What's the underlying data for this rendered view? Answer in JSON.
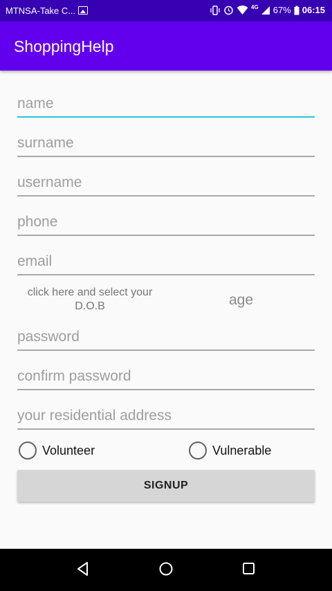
{
  "status_bar": {
    "carrier": "MTNSA-Take C...",
    "network": "4G",
    "battery": "67%",
    "time": "06:15"
  },
  "app_bar": {
    "title": "ShoppingHelp"
  },
  "form": {
    "name_placeholder": "name",
    "surname_placeholder": "surname",
    "username_placeholder": "username",
    "phone_placeholder": "phone",
    "email_placeholder": "email",
    "dob_label": "click here and select your D.O.B",
    "age_label": "age",
    "password_placeholder": "password",
    "confirm_password_placeholder": "confirm password",
    "address_placeholder": "your residential address",
    "radio_volunteer": "Volunteer",
    "radio_vulnerable": "Vulnerable",
    "signup_label": "SIGNUP"
  },
  "colors": {
    "status_bar": "#3700b3",
    "app_bar": "#6200ee",
    "focus_accent": "#26c6da"
  }
}
